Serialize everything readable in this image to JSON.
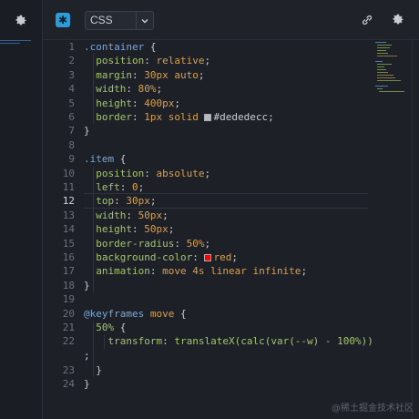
{
  "left_pane": {
    "settings_icon": "gear-icon"
  },
  "editor": {
    "badge_glyph": "✱",
    "language": "CSS",
    "link_icon": "link-icon",
    "settings_icon": "gear-icon",
    "active_line": 12,
    "line_numbers": [
      "1",
      "2",
      "3",
      "4",
      "5",
      "6",
      "7",
      "8",
      "9",
      "10",
      "11",
      "12",
      "13",
      "14",
      "15",
      "16",
      "17",
      "18",
      "19",
      "20",
      "21",
      "22",
      "",
      "23",
      "24"
    ]
  },
  "code": {
    "l1_sel": ".container",
    "l1_brace": " {",
    "l2_prop": "position",
    "l2_val": "relative",
    "l3_prop": "margin",
    "l3_val": "30px auto",
    "l4_prop": "width",
    "l4_val": "80%",
    "l5_prop": "height",
    "l5_val": "400px",
    "l6_prop": "border",
    "l6_val": "1px solid",
    "l6_color": "#dededecc",
    "l7": "}",
    "l9_sel": ".item",
    "l9_brace": " {",
    "l10_prop": "position",
    "l10_val": "absolute",
    "l11_prop": "left",
    "l11_val": "0",
    "l12_prop": "top",
    "l12_val": "30px",
    "l13_prop": "width",
    "l13_val": "50px",
    "l14_prop": "height",
    "l14_val": "50px",
    "l15_prop": "border-radius",
    "l15_val": "50%",
    "l16_prop": "background-color",
    "l16_color": "red",
    "l17_prop": "animation",
    "l17_val": "move 4s linear infinite",
    "l18": "}",
    "l20_kw": "@keyframes",
    "l20_name": "move",
    "l20_brace": " {",
    "l21_sel": "50%",
    "l21_brace": " {",
    "l22_prop": "transform",
    "l22_fn": "translateX(calc(var(--w) - 100%))",
    "l22b": ";",
    "l23": "}",
    "l24": "}"
  },
  "swatch_colors": {
    "border": "#dededecc",
    "red": "#ff0000"
  },
  "watermark": "@稀土掘金技术社区"
}
